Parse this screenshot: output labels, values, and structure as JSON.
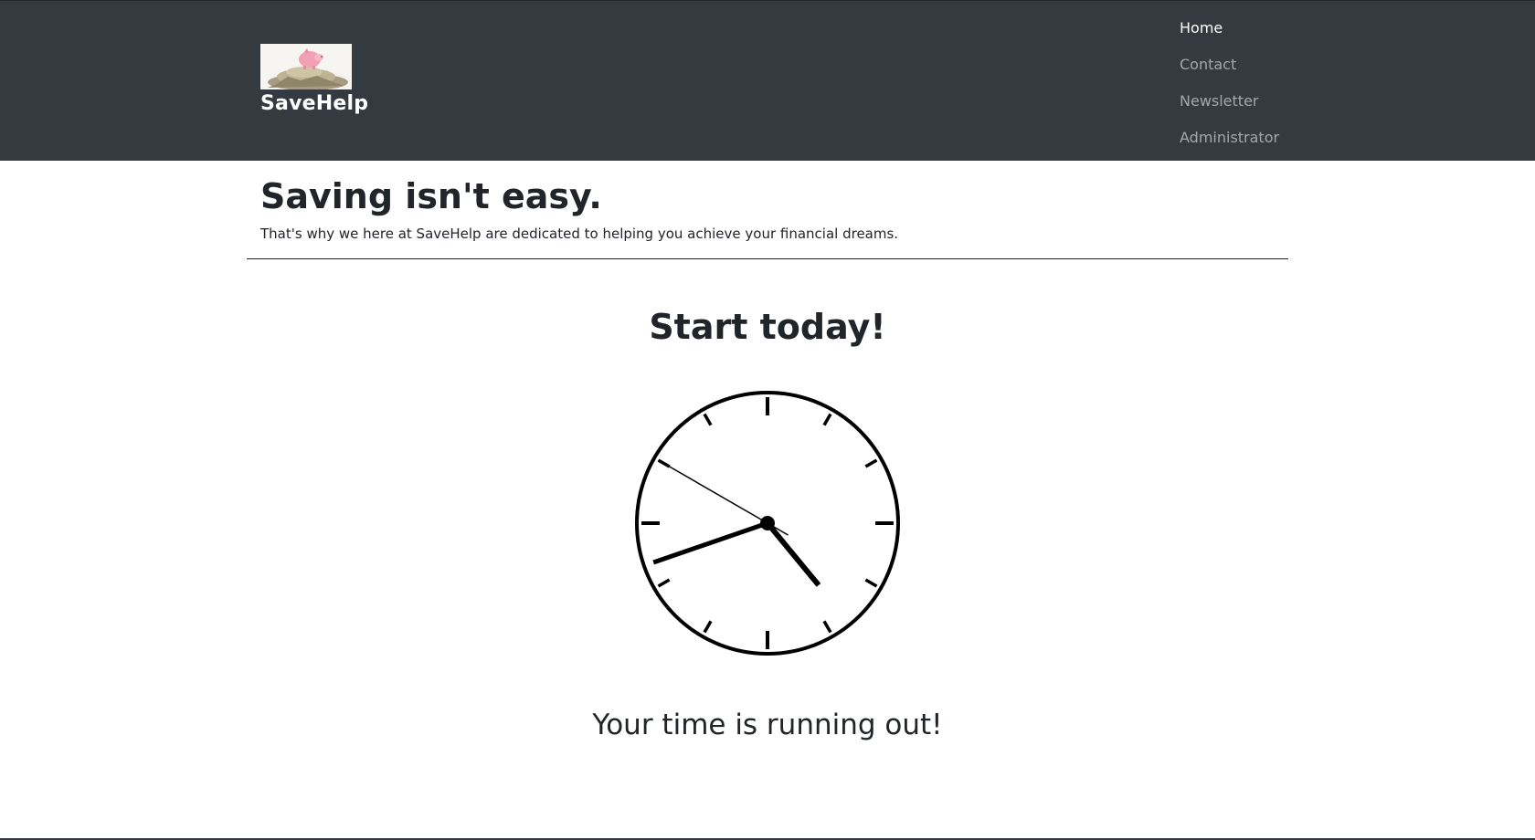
{
  "brand": {
    "name": "SaveHelp",
    "logo_alt": "piggy bank on coins"
  },
  "nav": {
    "items": [
      {
        "label": "Home",
        "active": true
      },
      {
        "label": "Contact",
        "active": false
      },
      {
        "label": "Newsletter",
        "active": false
      },
      {
        "label": "Administrator",
        "active": false
      }
    ]
  },
  "hero": {
    "title": "Saving isn't easy.",
    "lead": "That's why we here at SaveHelp are dedicated to helping you achieve your financial dreams."
  },
  "cta": {
    "top": "Start today!",
    "bottom": "Your time is running out!"
  },
  "clock": {
    "hours": 4,
    "minutes": 41,
    "seconds": 50
  },
  "colors": {
    "navbar": "#343a40",
    "text": "#212529",
    "nav_link": "rgba(255,255,255,0.55)"
  }
}
